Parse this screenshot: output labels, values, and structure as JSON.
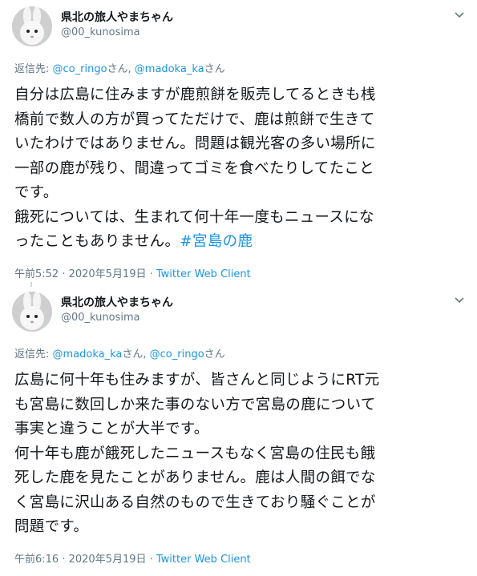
{
  "tweets": [
    {
      "name": "県北の旅人やまちゃん",
      "handle": "@00_kunosima",
      "reply_prefix": "返信先: ",
      "reply_to_1": "@co_ringo",
      "reply_sep_1": "さん, ",
      "reply_to_2": "@madoka_ka",
      "reply_sep_2": "さん",
      "lines": [
        "自分は広島に住みますが鹿煎餅を販売してるときも桟",
        "橋前で数人の方が買ってただけで、鹿は煎餅で生きて",
        "いたわけではありません。問題は観光客の多い場所に",
        "一部の鹿が残り、間違ってゴミを食べたりしてたこと",
        "です。",
        "餓死については、生まれて何十年一度もニュースにな",
        "ったこともありません。"
      ],
      "hashtag": "#宮島の鹿",
      "time": "午前5:52 · 2020年5月19日 · ",
      "client": "Twitter Web Client"
    },
    {
      "name": "県北の旅人やまちゃん",
      "handle": "@00_kunosima",
      "reply_prefix": "返信先: ",
      "reply_to_1": "@madoka_ka",
      "reply_sep_1": "さん, ",
      "reply_to_2": "@co_ringo",
      "reply_sep_2": "さん",
      "lines": [
        "広島に何十年も住みますが、皆さんと同じようにRT元",
        "も宮島に数回しか来た事のない方で宮島の鹿について",
        "事実と違うことが大半です。",
        "何十年も鹿が餓死したニュースもなく宮島の住民も餓",
        "死した鹿を見たことがありません。鹿は人間の餌でな",
        "く宮島に沢山ある自然のもので生きており騒ぐことが",
        "問題です。"
      ],
      "time": "午前6:16 · 2020年5月19日 · ",
      "client": "Twitter Web Client"
    }
  ],
  "icons": {
    "avatar": "rabbit-avatar-icon",
    "menu": "chevron-down-icon"
  },
  "colors": {
    "link": "#1b95e0",
    "secondary_text": "#657786",
    "primary_text": "#14171a"
  }
}
